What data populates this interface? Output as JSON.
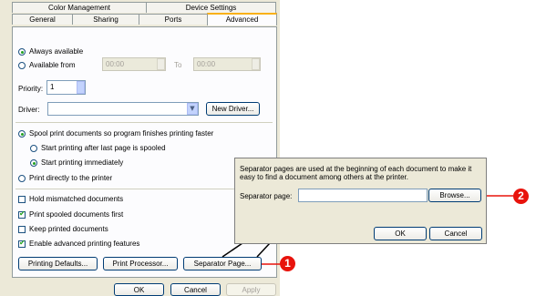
{
  "tabs": {
    "row1": [
      {
        "label": "Color Management"
      },
      {
        "label": "Device Settings"
      }
    ],
    "row2": [
      {
        "label": "General"
      },
      {
        "label": "Sharing"
      },
      {
        "label": "Ports"
      },
      {
        "label": "Advanced"
      }
    ]
  },
  "availability": {
    "always_label": "Always available",
    "from_label": "Available from",
    "from_time": "00:00",
    "to_label": "To",
    "to_time": "00:00"
  },
  "priority": {
    "label": "Priority:",
    "value": "1"
  },
  "driver": {
    "label": "Driver:",
    "value": "",
    "new_driver_button": "New Driver..."
  },
  "spooling": {
    "spool_label": "Spool print documents so program finishes printing faster",
    "after_last_label": "Start printing after last page is spooled",
    "immediately_label": "Start printing immediately",
    "direct_label": "Print directly to the printer"
  },
  "options": [
    {
      "label": "Hold mismatched documents",
      "checked": false
    },
    {
      "label": "Print spooled documents first",
      "checked": true
    },
    {
      "label": "Keep printed documents",
      "checked": false
    },
    {
      "label": "Enable advanced printing features",
      "checked": true
    }
  ],
  "bottom_buttons": {
    "printing_defaults": "Printing Defaults...",
    "print_processor": "Print Processor...",
    "separator_page": "Separator Page..."
  },
  "dialog_buttons": {
    "ok": "OK",
    "cancel": "Cancel",
    "apply": "Apply"
  },
  "separator_dialog": {
    "description": "Separator pages are used at the beginning of each document to make it easy to find a document among others at the printer.",
    "field_label": "Separator page:",
    "field_value": "",
    "browse_button": "Browse...",
    "ok_button": "OK",
    "cancel_button": "Cancel"
  },
  "callouts": {
    "one": "1",
    "two": "2"
  },
  "colors": {
    "callout": "#e8130c",
    "tab_highlight": "#f9b119",
    "window": "#ece9d8"
  }
}
